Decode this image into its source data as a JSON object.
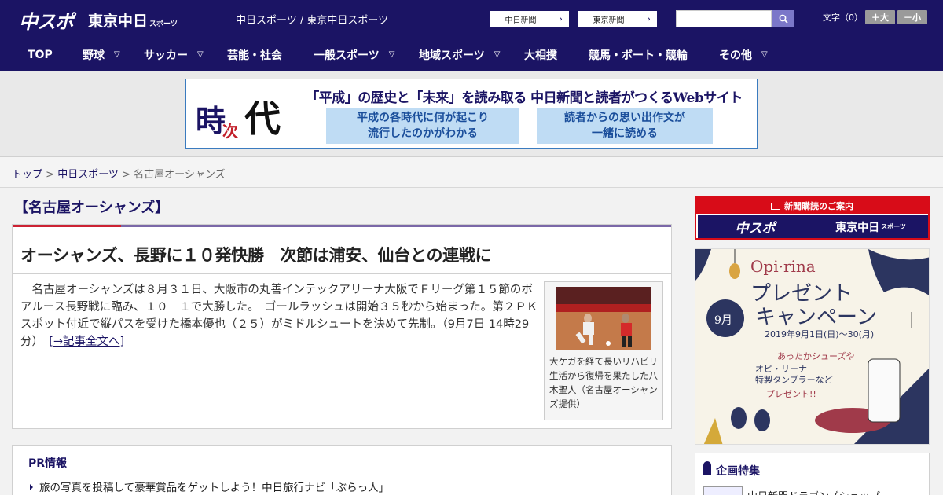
{
  "header": {
    "logo_primary": "中スポ",
    "logo_secondary": "東京中日",
    "logo_secondary_small": "スポーツ",
    "site_title": "中日スポーツ / 東京中日スポーツ",
    "paper_links": [
      "中日新聞",
      "東京新聞"
    ],
    "search_placeholder": "",
    "font_size_label": "文字（0）",
    "font_larger": "＋大",
    "font_smaller": "－小"
  },
  "nav": {
    "items": [
      {
        "label": "TOP",
        "dropdown": false
      },
      {
        "label": "野球",
        "dropdown": true
      },
      {
        "label": "サッカー",
        "dropdown": true
      },
      {
        "label": "芸能・社会",
        "dropdown": false
      },
      {
        "label": "一般スポーツ",
        "dropdown": true
      },
      {
        "label": "地域スポーツ",
        "dropdown": true
      },
      {
        "label": "大相撲",
        "dropdown": false
      },
      {
        "label": "競馬・ボート・競輪",
        "dropdown": false
      },
      {
        "label": "その他",
        "dropdown": true
      }
    ]
  },
  "banner": {
    "logo_chars": [
      "時",
      "次",
      "代"
    ],
    "headline": "「平成」の歴史と「未来」を読み取る 中日新聞と読者がつくるWebサイト",
    "box_left": [
      "平成の各時代に何が起こり",
      "流行したのかがわかる"
    ],
    "box_right": [
      "読者からの思い出作文が",
      "一緒に読める"
    ]
  },
  "breadcrumb": {
    "home": "トップ",
    "sep": " > ",
    "section": "中日スポーツ",
    "current": "名古屋オーシャンズ"
  },
  "main": {
    "section_title": "【名古屋オーシャンズ】",
    "article": {
      "title": "オーシャンズ、長野に１０発快勝　次節は浦安、仙台との連戦に",
      "body": "　名古屋オーシャンズは８月３１日、大阪市の丸善インテックアリーナ大阪でＦリーグ第１５節のボアルース長野戦に臨み、１０－１で大勝した。　ゴールラッシュは開始３５秒から始まった。第２ＰＫスポット付近で縦パスを受けた橋本優也（２５）がミドルシュートを決めて先制。（9月7日 14時29分）",
      "more_link": "[→記事全文へ]",
      "photo_caption": "大ケガを経て長いリハビリ生活から復帰を果たした八木聖人（名古屋オーシャンズ提供）"
    },
    "pr": {
      "title": "PR情報",
      "items": [
        "旅の写真を投稿して豪華賞品をゲットしよう！中日旅行ナビ「ぶらっ人」"
      ]
    }
  },
  "sidebar": {
    "subscribe_head": "新聞購読のご案内",
    "subscribe_buttons": [
      "中スポ",
      "東京中日"
    ],
    "subscribe_small": "スポーツ",
    "promo": {
      "brand": "Opi·rina",
      "title_line1": "プレゼント",
      "title_line2": "キャンペーン",
      "month": "9月",
      "dates": "2019年9月1日(日)〜30(月)",
      "copy1": "あったかシューズや",
      "copy2": "オピ・リーナ",
      "copy3": "特製タンブラーなど",
      "copy4": "プレゼント!!"
    },
    "feature": {
      "title": "企画特集",
      "items": [
        "中日新聞ドラゴンズショップ"
      ]
    }
  },
  "colors": {
    "brand_navy": "#1b1464",
    "accent_red": "#d80c18",
    "link": "#1b1464"
  }
}
